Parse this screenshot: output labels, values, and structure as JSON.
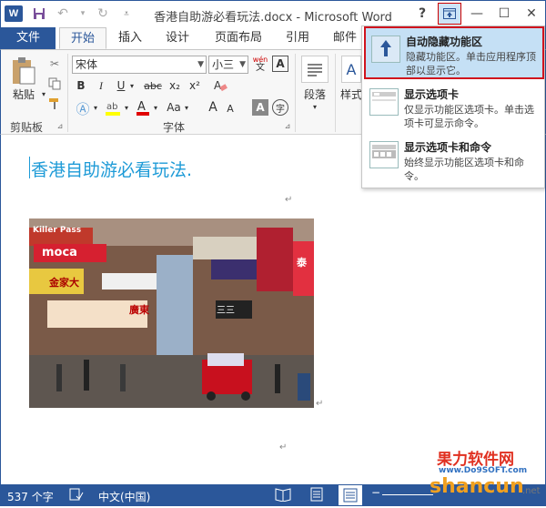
{
  "window": {
    "title": "香港自助游必看玩法.docx - Microsoft Word",
    "help": "?",
    "app_logo": "W"
  },
  "tabs": [
    {
      "label": "文件"
    },
    {
      "label": "开始"
    },
    {
      "label": "插入"
    },
    {
      "label": "设计"
    },
    {
      "label": "页面布局"
    },
    {
      "label": "引用"
    },
    {
      "label": "邮件"
    }
  ],
  "ribbon": {
    "paste_label": "粘贴",
    "clipboard_group": "剪贴板",
    "font_group": "字体",
    "font_name": "宋体",
    "font_size": "小三",
    "wen_glyph": "wén",
    "paragraph_label": "段落",
    "style_label": "样式",
    "bold": "B",
    "italic": "I",
    "underline": "U",
    "strikethrough": "abc",
    "subscript": "x₂",
    "superscript": "x²",
    "font_color_a": "A",
    "case_label": "Aa",
    "grow_font": "A",
    "shrink_font": "A",
    "char_border": "A",
    "char_shading": "A",
    "phonetic": "字"
  },
  "dropdown": {
    "items": [
      {
        "title": "自动隐藏功能区",
        "desc": "隐藏功能区。单击应用程序顶部以显示它。",
        "icon": "auto-hide-ribbon-icon"
      },
      {
        "title": "显示选项卡",
        "desc": "仅显示功能区选项卡。单击选项卡可显示命令。",
        "icon": "show-tabs-icon"
      },
      {
        "title": "显示选项卡和命令",
        "desc": "始终显示功能区选项卡和命令。",
        "icon": "show-tabs-commands-icon"
      }
    ]
  },
  "document": {
    "heading": "香港自助游必看玩法.",
    "para_mark": "↵"
  },
  "status": {
    "word_count": "537 个字",
    "language": "中文(中国)"
  },
  "photo_signs": [
    "Killer Pass",
    "moca",
    "金家大",
    "三三",
    "廣東",
    "泰"
  ],
  "watermark": {
    "line1": "果力软件网",
    "line2": "www.Do9SOFT.com",
    "line3": "shancun",
    "line4": ".net"
  },
  "colors": {
    "brand": "#2b579a",
    "heading": "#1e9bd7",
    "highlight_border": "#d0141e"
  }
}
